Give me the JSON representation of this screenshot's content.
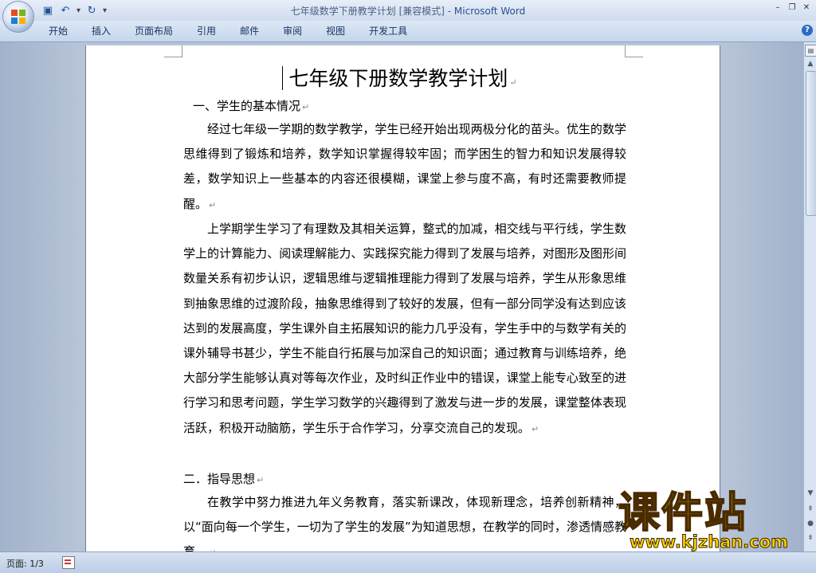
{
  "window": {
    "title_doc": "七年级数学下册教学计划 [兼容模式] - ",
    "title_app": "Microsoft Word"
  },
  "quick_access": {
    "items": [
      {
        "name": "save-icon",
        "glyph": "▣"
      },
      {
        "name": "undo-icon",
        "glyph": "↶"
      },
      {
        "name": "redo-icon",
        "glyph": "↻"
      }
    ]
  },
  "ribbon": {
    "tabs": [
      "开始",
      "插入",
      "页面布局",
      "引用",
      "邮件",
      "审阅",
      "视图",
      "开发工具"
    ]
  },
  "document": {
    "title": "七年级下册数学教学计划",
    "section1_heading": "一、学生的基本情况",
    "para1": "经过七年级一学期的数学教学，学生已经开始出现两极分化的苗头。优生的数学思维得到了锻炼和培养，数学知识掌握得较牢固；而学困生的智力和知识发展得较差，数学知识上一些基本的内容还很模糊，课堂上参与度不高，有时还需要教师提醒。",
    "para2": "上学期学生学习了有理数及其相关运算，整式的加减，相交线与平行线，学生数学上的计算能力、阅读理解能力、实践探究能力得到了发展与培养，对图形及图形间数量关系有初步认识，逻辑思维与逻辑推理能力得到了发展与培养，学生从形象思维到抽象思维的过渡阶段，抽象思维得到了较好的发展，但有一部分同学没有达到应该达到的发展高度，学生课外自主拓展知识的能力几乎没有，学生手中的与数学有关的课外辅导书甚少，学生不能自行拓展与加深自己的知识面；通过教育与训练培养，绝大部分学生能够认真对等每次作业，及时纠正作业中的错误，课堂上能专心致至的进行学习和思考问题，学生学习数学的兴趣得到了激发与进一步的发展，课堂整体表现活跃，积极开动脑筋，学生乐于合作学习，分享交流自己的发现。",
    "section2_heading": "二．指导思想",
    "para3": "在教学中努力推进九年义务教育，落实新课改，体现新理念，培养创新精神，以“面向每一个学生，一切为了学生的发展”为知道思想，在教学的同时，渗透情感教育。",
    "paragraph_mark": "↵"
  },
  "status": {
    "page": "页面: 1/3"
  },
  "watermark": {
    "text": "课件站",
    "url": "www.kjzhan.com"
  }
}
